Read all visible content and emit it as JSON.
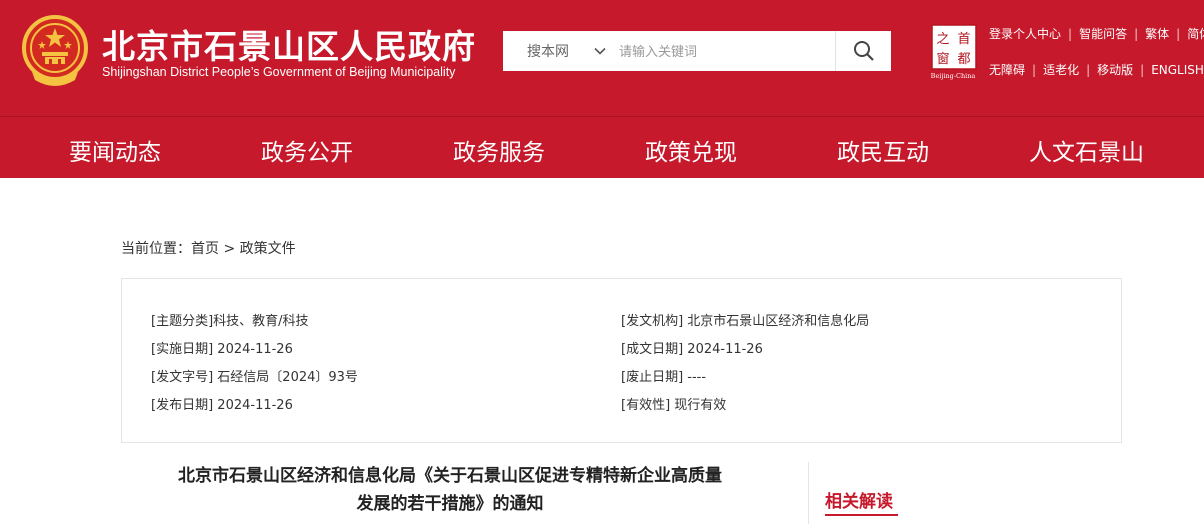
{
  "header": {
    "site_title": "北京市石景山区人民政府",
    "site_subtitle": "Shijingshan District People’s Government of Beijing Municipality",
    "search": {
      "scope": "搜本网",
      "placeholder": "请输入关键词"
    },
    "seal": {
      "chars": [
        "之",
        "首",
        "窗",
        "都"
      ],
      "caption": "Beijing-China"
    },
    "links_row1": [
      "登录个人中心",
      "智能问答",
      "繁体",
      "简体"
    ],
    "links_row2": [
      "无障碍",
      "适老化",
      "移动版",
      "ENGLISH"
    ]
  },
  "nav": [
    "要闻动态",
    "政务公开",
    "政务服务",
    "政策兑现",
    "政民互动",
    "人文石景山"
  ],
  "breadcrumb": {
    "prefix": "当前位置：",
    "home": "首页",
    "separator": " > ",
    "current": "政策文件"
  },
  "meta": {
    "subject_label": "[主题分类]",
    "subject": "科技、教育/科技",
    "issuer_label": "[发文机构]",
    "issuer": "北京市石景山区经济和信息化局",
    "effective_label": "[实施日期]",
    "effective": "2024-11-26",
    "created_label": "[成文日期]",
    "created": "2024-11-26",
    "docno_label": "[发文字号]",
    "docno": "石经信局〔2024〕93号",
    "repeal_label": "[废止日期]",
    "repeal": "----",
    "published_label": "[发布日期]",
    "published": "2024-11-26",
    "validity_label": "[有效性]",
    "validity": "现行有效"
  },
  "document": {
    "title_line1": "北京市石景山区经济和信息化局《关于石景山区促进专精特新企业高质量",
    "title_line2": "发展的若干措施》的通知"
  },
  "sidebar": {
    "related_title": "相关解读"
  },
  "colors": {
    "brand_red": "#c6192b",
    "emblem_gold": "#f5c242"
  }
}
